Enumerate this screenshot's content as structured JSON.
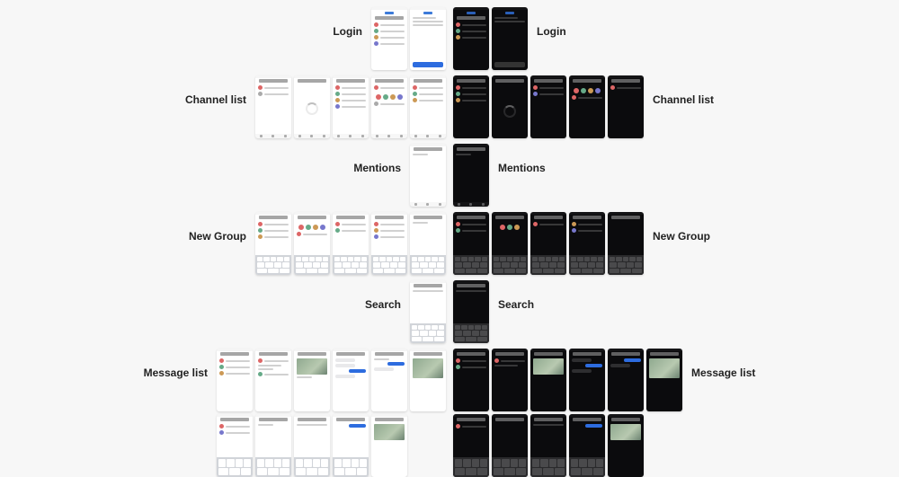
{
  "themes": {
    "light": "Light",
    "dark": "Dark"
  },
  "sections": {
    "login": "Login",
    "channel_list": "Channel list",
    "mentions": "Mentions",
    "new_group": "New Group",
    "search": "Search",
    "message_list": "Message list"
  },
  "screen_counts": {
    "login": 2,
    "channel_list": 5,
    "mentions": 1,
    "new_group": 5,
    "search": 1,
    "message_list_row1": 6,
    "message_list_row2": 5
  },
  "colors": {
    "primary_button": "#2d6cdf",
    "light_bg": "#ffffff",
    "dark_bg": "#0b0b0d",
    "keyboard_light": "#d1d4d9",
    "keyboard_dark": "#2a2a2c"
  }
}
